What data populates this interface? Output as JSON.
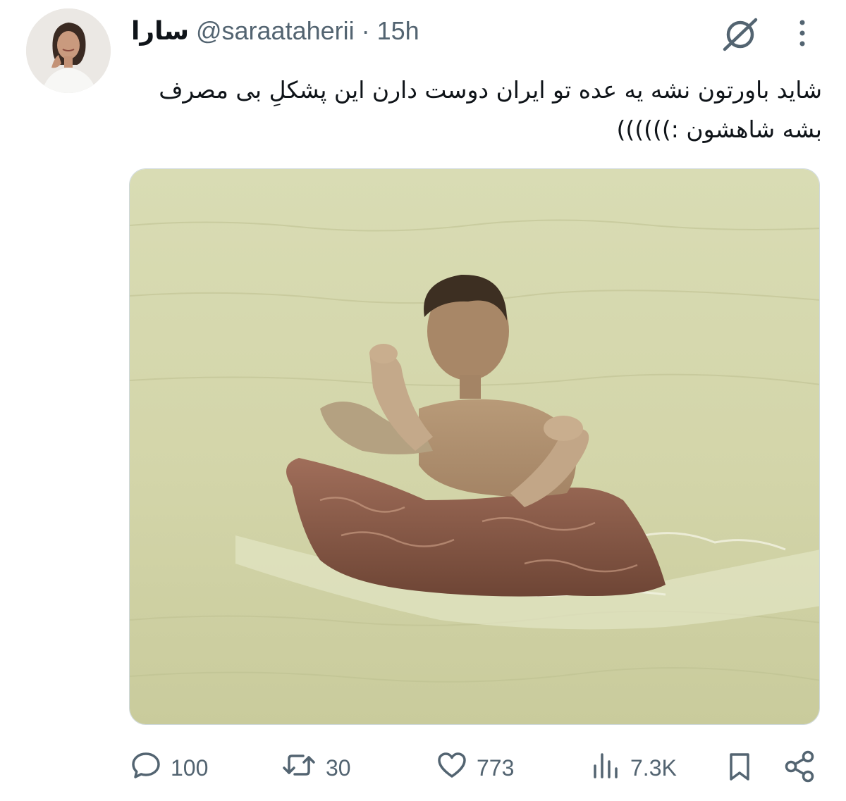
{
  "tweet": {
    "display_name": "سارا",
    "handle": "@saraataherii",
    "separator": "·",
    "time": "15h",
    "text_line1": "شاید باورتون نشه یه عده تو ایران دوست دارن این پشکلِ بی مصرف",
    "text_line2": "بشه شاهشون :))))))"
  },
  "icons": {
    "grok": "grok-icon",
    "more": "more-vertical-icon",
    "reply": "reply-icon",
    "retweet": "retweet-icon",
    "like": "heart-icon",
    "views": "views-chart-icon",
    "bookmark": "bookmark-icon",
    "share": "share-icon"
  },
  "actions": {
    "replies": "100",
    "retweets": "30",
    "likes": "773",
    "views": "7.3K"
  },
  "colors": {
    "text_primary": "#0f1419",
    "text_secondary": "#536471",
    "photo_water": "#d4d6ab"
  }
}
